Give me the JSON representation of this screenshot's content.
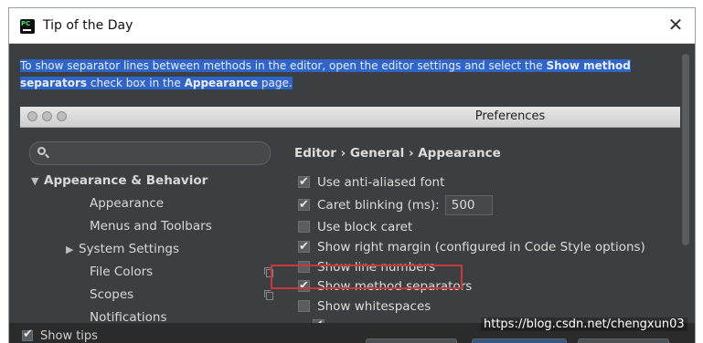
{
  "window": {
    "title": "Tip of the Day",
    "close_glyph": "✕"
  },
  "tip": {
    "text_1": "To show separator lines between methods in the editor, open the editor settings and select the ",
    "bold_1": "Show method separators",
    "text_2": " check box in the ",
    "bold_2": "Appearance",
    "text_3": " page."
  },
  "preferences": {
    "title": "Preferences",
    "breadcrumb": "Editor › General › Appearance",
    "tree": [
      {
        "label": "Appearance & Behavior",
        "bold": true,
        "arrow": "▼"
      },
      {
        "label": "Appearance"
      },
      {
        "label": "Menus and Toolbars"
      },
      {
        "label": "System Settings",
        "arrow": "▶"
      },
      {
        "label": "File Colors",
        "icon": "copy-icon"
      },
      {
        "label": "Scopes",
        "icon": "copy-icon"
      },
      {
        "label": "Notifications"
      }
    ],
    "options": [
      {
        "label": "Use anti-aliased font",
        "checked": true
      },
      {
        "label": "Caret blinking (ms):",
        "checked": true,
        "value": "500"
      },
      {
        "label": "Use block caret",
        "checked": false
      },
      {
        "label": "Show right margin (configured in Code Style options)",
        "checked": true
      },
      {
        "label": "Show line numbers",
        "checked": false
      },
      {
        "label": "Show method separators",
        "checked": true,
        "highlighted": true
      },
      {
        "label": "Show whitespaces",
        "checked": false
      }
    ]
  },
  "footer": {
    "show_tips_label": "Show tips"
  },
  "watermark": "https://blog.csdn.net/chengxun03",
  "colors": {
    "dialog_bg": "#3c3f41",
    "selection": "#2f65ca",
    "highlight_border": "#c83a3a"
  }
}
